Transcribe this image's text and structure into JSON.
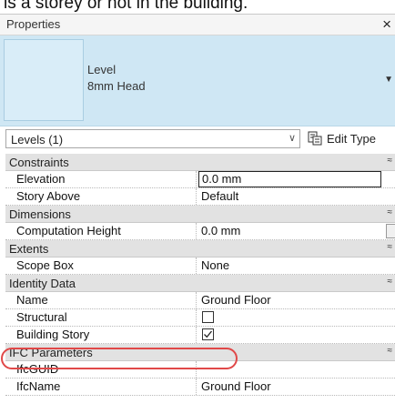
{
  "caption": "is a storey or not in the building.",
  "panel": {
    "title": "Properties",
    "close_glyph": "×"
  },
  "type_selector": {
    "family": "Level",
    "type_name": "8mm Head",
    "dropdown_glyph": "▼"
  },
  "filter": {
    "label": "Levels (1)",
    "arrow_glyph": "∨",
    "edit_type_label": "Edit Type",
    "edit_type_icon": "edit-type-icon"
  },
  "groups": [
    {
      "label": "Constraints",
      "rows": [
        {
          "name": "Elevation",
          "value": "0.0 mm",
          "editing": true
        },
        {
          "name": "Story Above",
          "value": "Default"
        }
      ]
    },
    {
      "label": "Dimensions",
      "rows": [
        {
          "name": "Computation Height",
          "value": "0.0 mm"
        }
      ]
    },
    {
      "label": "Extents",
      "rows": [
        {
          "name": "Scope Box",
          "value": "None"
        }
      ]
    },
    {
      "label": "Identity Data",
      "rows": [
        {
          "name": "Name",
          "value": "Ground Floor"
        },
        {
          "name": "Structural",
          "checked": false
        },
        {
          "name": "Building Story",
          "checked": true
        }
      ]
    },
    {
      "label": "IFC Parameters",
      "rows": [
        {
          "name": "IfcGUID",
          "value": ""
        },
        {
          "name": "IfcName",
          "value": "Ground Floor"
        }
      ]
    }
  ],
  "collapse_glyph": "≈",
  "colors": {
    "type_bg": "#cfe7f4",
    "group_bg": "#e2e2e2",
    "highlight": "#e04848"
  }
}
